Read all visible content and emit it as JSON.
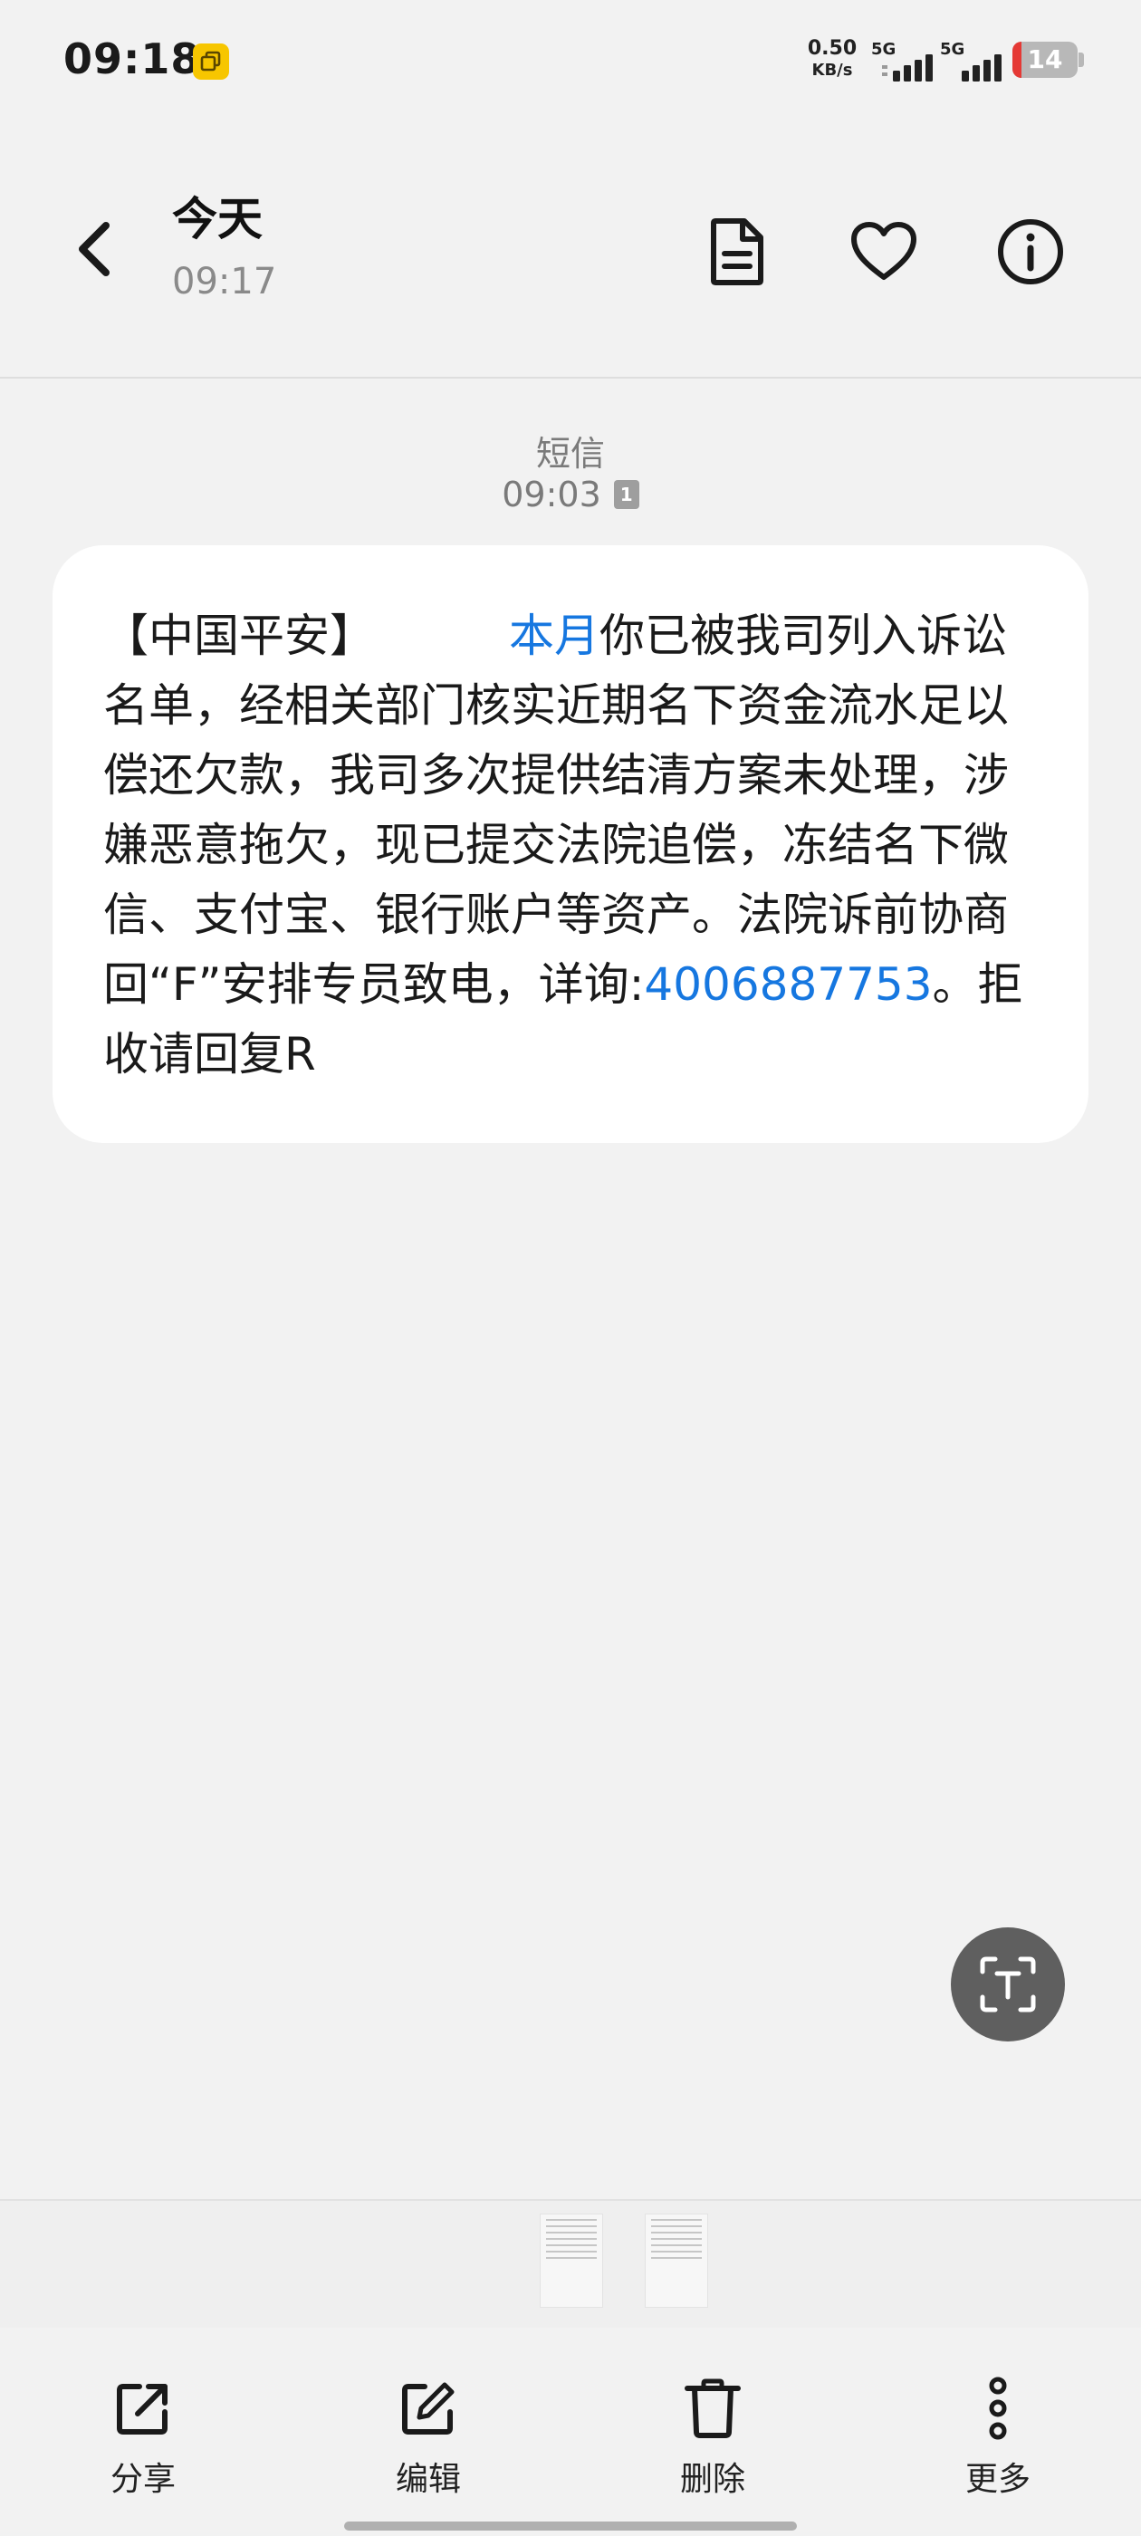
{
  "status_bar": {
    "time": "09:18",
    "net_speed_value": "0.50",
    "net_speed_unit": "KB/s",
    "signal_1_label": "5G",
    "signal_2_label": "5G",
    "battery_level": "14"
  },
  "header": {
    "title": "今天",
    "subtitle": "09:17"
  },
  "message": {
    "type_label": "短信",
    "time": "09:03",
    "sim_badge": "1",
    "text_part1": "【中国平安】",
    "text_link1": "本月",
    "text_part2": "你已被我司列入诉讼名单，经相关部门核实近期名下资金流水足以偿还欠款，我司多次提供结清方案未处理，涉嫌恶意拖欠，现已提交法院追偿，冻结名下微信、支付宝、银行账户等资产。法院诉前协商回“F”安排专员致电，详询:",
    "text_phone": "4006887753",
    "text_part3": "。拒收请回复R"
  },
  "toolbar": {
    "share_label": "分享",
    "edit_label": "编辑",
    "delete_label": "删除",
    "more_label": "更多"
  },
  "colors": {
    "link": "#1677e0",
    "background": "#f2f2f2",
    "bubble": "#ffffff",
    "battery_low": "#e53935"
  },
  "icons": [
    "back-arrow-icon",
    "document-icon",
    "heart-icon",
    "info-icon",
    "text-extract-icon",
    "share-icon",
    "edit-icon",
    "delete-icon",
    "more-icon"
  ]
}
